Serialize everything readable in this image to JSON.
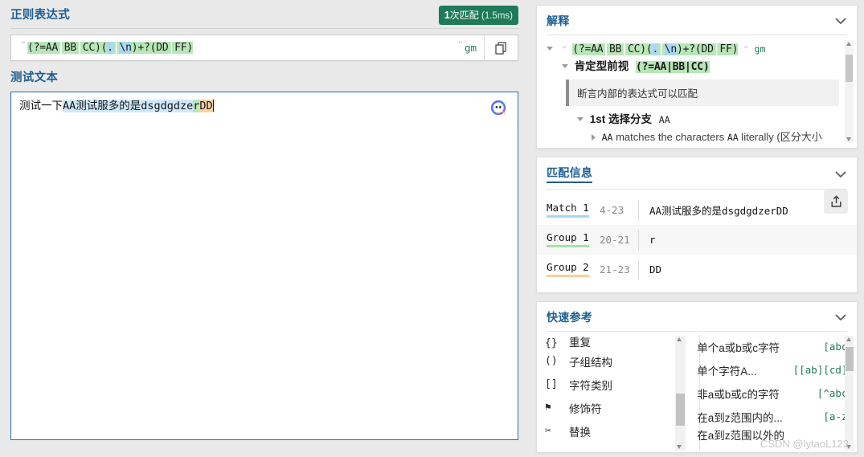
{
  "left": {
    "regex_section_title": "正则表达式",
    "match_badge": {
      "count": "1",
      "label": "次匹配",
      "time": "(1.5ms)"
    },
    "regex": {
      "parts": [
        {
          "text": "(?=AA",
          "style": "green"
        },
        {
          "text": "|",
          "style": "bar-green"
        },
        {
          "text": "BB",
          "style": "green"
        },
        {
          "text": "|",
          "style": "bar-green"
        },
        {
          "text": "CC)(",
          "style": "green"
        },
        {
          "text": ".",
          "style": "blue"
        },
        {
          "text": "|",
          "style": "bar-green"
        },
        {
          "text": "\\n",
          "style": "blue"
        },
        {
          "text": ")+?(DD",
          "style": "green"
        },
        {
          "text": "|",
          "style": "bar-green"
        },
        {
          "text": "FF)",
          "style": "green"
        }
      ],
      "full": "(?=AA|BB|CC)(.|\\n)+?(DD|FF)",
      "flags": "gm",
      "delimiter": "″"
    },
    "copy_icon": "copy-icon",
    "test_section_title": "测试文本",
    "test_text": {
      "plain_prefix": "测试一下",
      "match_segment": "AA测试服多的是dsgdgdze",
      "group1_segment": "r",
      "group2_segment": "DD"
    }
  },
  "explanation": {
    "title": "解释",
    "root": {
      "regex_parts": [
        {
          "text": "(?=AA",
          "style": "green"
        },
        {
          "text": "|",
          "style": "bar-green"
        },
        {
          "text": "BB",
          "style": "green"
        },
        {
          "text": "|",
          "style": "bar-green"
        },
        {
          "text": "CC)(",
          "style": "green"
        },
        {
          "text": ".",
          "style": "blue"
        },
        {
          "text": "|",
          "style": "bar-green"
        },
        {
          "text": "\\n",
          "style": "blue"
        },
        {
          "text": ")+?(DD",
          "style": "green"
        },
        {
          "text": "|",
          "style": "bar-green"
        },
        {
          "text": "FF)",
          "style": "green"
        }
      ],
      "flags": "gm"
    },
    "node_lookahead_label": "肯定型前视",
    "node_lookahead_code": "(?=AA|BB|CC)",
    "note": "断言内部的表达式可以匹配",
    "node_alt_label": "1st 选择分支",
    "node_alt_code": "AA",
    "leaf_line_pre": "AA",
    "leaf_line_mid": " matches the characters ",
    "leaf_line_code": "AA",
    "leaf_line_post": " literally (区分大小"
  },
  "match_info": {
    "title": "匹配信息",
    "share_icon": "share-icon",
    "rows": [
      {
        "name": "Match 1",
        "range": "4-23",
        "value": "AA测试服多的是dsgdgdzerDD",
        "underline": "blue"
      },
      {
        "name": "Group 1",
        "range": "20-21",
        "value": "r",
        "underline": "green"
      },
      {
        "name": "Group 2",
        "range": "21-23",
        "value": "DD",
        "underline": "orange"
      }
    ]
  },
  "quick_ref": {
    "title": "快速参考",
    "left_items": [
      {
        "icon": "{}",
        "label": "重复",
        "clipped": true
      },
      {
        "icon": "()",
        "label": "子组结构",
        "clipped": false
      },
      {
        "icon": "[]",
        "label": "字符类别",
        "clipped": false
      },
      {
        "icon": "⚑",
        "label": "修饰符",
        "clipped": false
      },
      {
        "icon": "✂",
        "label": "替换",
        "clipped": false
      }
    ],
    "right_items": [
      {
        "label": "单个a或b或c字符",
        "code": "[abc]",
        "clipped": false
      },
      {
        "label": "单个字符A...",
        "code": "[[ab][cd]]",
        "clipped": false
      },
      {
        "label": "非a或b或c的字符",
        "code": "[^abc]",
        "clipped": false
      },
      {
        "label": "在a到z范围内的...",
        "code": "[a-z]",
        "clipped": false
      },
      {
        "label": "在a到z范围以外的",
        "code": "",
        "clipped": true
      }
    ]
  },
  "watermark": "CSDN @lytaoL123",
  "colors": {
    "accent_blue": "#1f5e93",
    "badge_green": "#1f7a5a",
    "hl_green": "#b8e6b8",
    "hl_blue": "#a8d8f5",
    "hl_lightblue": "#cfe9fb",
    "hl_orange": "#fad2a4",
    "flag_green": "#1f7a4d"
  }
}
